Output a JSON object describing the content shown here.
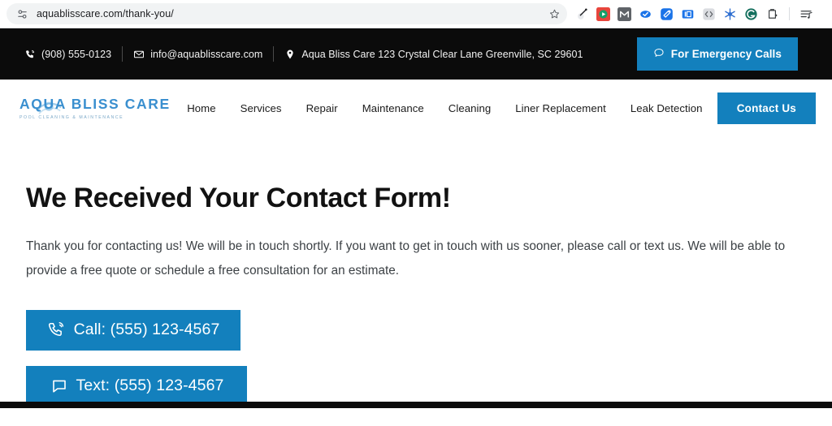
{
  "browser": {
    "url": "aquablisscare.com/thank-you/",
    "page_info_icon": "page-settings-icon",
    "bookmark_icon": "star-icon",
    "extensions": [
      {
        "name": "eyedropper-icon",
        "label": ""
      },
      {
        "name": "video-recorder-icon",
        "label": ""
      },
      {
        "name": "mailmeteor-icon",
        "label": "M"
      },
      {
        "name": "grammar-check-icon",
        "label": ""
      },
      {
        "name": "tag-manager-icon",
        "label": ""
      },
      {
        "name": "bitly-icon",
        "label": ""
      },
      {
        "name": "code-snippet-icon",
        "label": ""
      },
      {
        "name": "snowflake-icon",
        "label": ""
      },
      {
        "name": "grammarly-icon",
        "label": "G"
      },
      {
        "name": "clipboard-icon",
        "label": ""
      }
    ],
    "reading_list_icon": "reading-list-icon"
  },
  "topbar": {
    "phone": "(908) 555-0123",
    "phone_icon": "phone-ring-icon",
    "email": "info@aquablisscare.com",
    "email_icon": "envelope-icon",
    "address": "Aqua Bliss Care 123 Crystal Clear Lane Greenville, SC 29601",
    "address_icon": "location-pin-icon",
    "emergency_label": "For Emergency Calls",
    "emergency_icon": "chat-bubble-icon",
    "background": "#0b0b0b",
    "accent": "#1380bd"
  },
  "header": {
    "logo": {
      "main": "AQUA BLISS CARE",
      "sub": "POOL CLEANING & MAINTENANCE",
      "icon": "water-swoosh-icon",
      "color": "#3a8fcf"
    },
    "nav": [
      {
        "label": "Home"
      },
      {
        "label": "Services"
      },
      {
        "label": "Repair"
      },
      {
        "label": "Maintenance"
      },
      {
        "label": "Cleaning"
      },
      {
        "label": "Liner Replacement"
      },
      {
        "label": "Leak Detection"
      }
    ],
    "contact_label": "Contact Us"
  },
  "main": {
    "title": "We Received Your Contact Form!",
    "paragraph": "Thank you for contacting us! We will be in touch shortly. If you want to get in touch with us sooner, please call or text us. We will be able to provide a free quote or schedule a free consultation for an estimate.",
    "call_label": "Call: (555) 123-4567",
    "call_icon": "phone-ring-icon",
    "text_label": "Text: (555) 123-4567",
    "text_icon": "chat-bubble-icon",
    "accent": "#1380bd"
  }
}
